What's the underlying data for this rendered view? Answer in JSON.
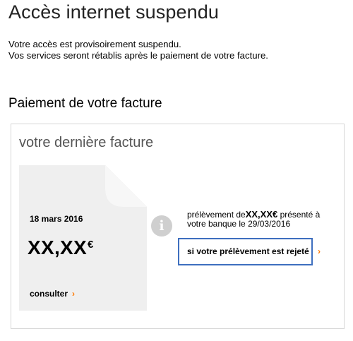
{
  "header": {
    "title": "Accès internet suspendu"
  },
  "intro": {
    "line1": "Votre accès est provisoirement suspendu.",
    "line2": "Vos services seront rétablis après le paiement de votre facture."
  },
  "payment": {
    "section_title": "Paiement de votre facture",
    "card": {
      "title": "votre dernière facture",
      "invoice": {
        "date": "18 mars 2016",
        "amount": "XX,XX",
        "currency": "€",
        "consult_label": "consulter"
      },
      "info": {
        "text_prefix": "prélèvement de",
        "amount": "XX,XX€",
        "text_suffix": " présenté à votre banque le 29/03/2016",
        "reject_link_label": "si votre prélèvement est rejeté"
      }
    }
  },
  "colors": {
    "accent": "#ff7900",
    "highlight_border": "#3e6fbf",
    "document_bg": "#efefef",
    "info_icon": "#cfcfcf"
  },
  "icons": {
    "chevron": "chevron-right-icon",
    "info": "info-icon"
  }
}
